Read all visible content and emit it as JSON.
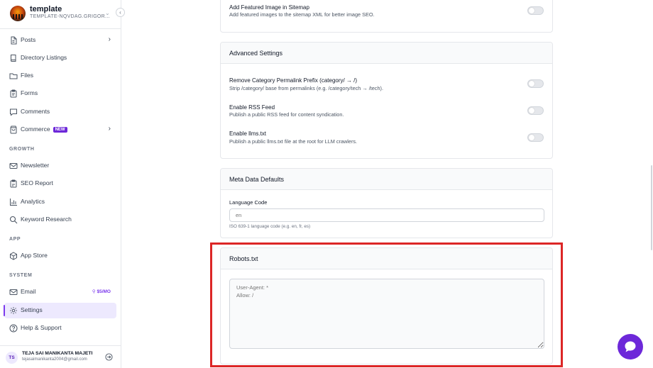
{
  "workspace": {
    "name": "template",
    "subdomain": "TEMPLATE-NQVDAG.GRIGOR..."
  },
  "sidebar": {
    "items_main": [
      {
        "label": "Posts",
        "icon": "document-icon",
        "has_chevron": true
      },
      {
        "label": "Directory Listings",
        "icon": "book-icon"
      },
      {
        "label": "Files",
        "icon": "folder-icon"
      },
      {
        "label": "Forms",
        "icon": "clipboard-icon"
      },
      {
        "label": "Comments",
        "icon": "comment-icon"
      },
      {
        "label": "Commerce",
        "icon": "bag-icon",
        "badge": "NEW",
        "has_chevron": true
      }
    ],
    "section_growth": "GROWTH",
    "items_growth": [
      {
        "label": "Newsletter",
        "icon": "mail-icon"
      },
      {
        "label": "SEO Report",
        "icon": "report-icon"
      },
      {
        "label": "Analytics",
        "icon": "chart-icon"
      },
      {
        "label": "Keyword Research",
        "icon": "search-icon"
      }
    ],
    "section_app": "APP",
    "items_app": [
      {
        "label": "App Store",
        "icon": "box-icon"
      }
    ],
    "section_system": "SYSTEM",
    "items_system": [
      {
        "label": "Email",
        "icon": "mail-icon",
        "price": "$5/MO"
      },
      {
        "label": "Settings",
        "icon": "gear-icon",
        "active": true
      },
      {
        "label": "Help & Support",
        "icon": "help-icon"
      }
    ],
    "accent": "#7c3aed"
  },
  "user": {
    "initials": "TS",
    "name": "TEJA SAI MANIKANTA MAJETI",
    "email": "tejasaimanikanta2004@gmail.com"
  },
  "sitemap": {
    "setting_title": "Add Featured Image in Sitemap",
    "setting_desc": "Add featured images to the sitemap XML for better image SEO.",
    "enabled": false
  },
  "advanced": {
    "title": "Advanced Settings",
    "settings": [
      {
        "title": "Remove Category Permalink Prefix (category/ → /)",
        "desc": "Strip /category/ base from permalinks (e.g. /category/tech → /tech).",
        "enabled": false
      },
      {
        "title": "Enable RSS Feed",
        "desc": "Publish a public RSS feed for content syndication.",
        "enabled": false
      },
      {
        "title": "Enable llms.txt",
        "desc": "Publish a public llms.txt file at the root for LLM crawlers.",
        "enabled": false
      }
    ]
  },
  "meta": {
    "title": "Meta Data Defaults",
    "language_label": "Language Code",
    "language_placeholder": "en",
    "language_hint": "ISO 639-1 language code (e.g. en, fr, es)"
  },
  "robots": {
    "title": "Robots.txt",
    "placeholder": "User-Agent: *\nAllow: /"
  },
  "colors": {
    "highlight": "#dc2626",
    "chat": "#6d28d9"
  }
}
